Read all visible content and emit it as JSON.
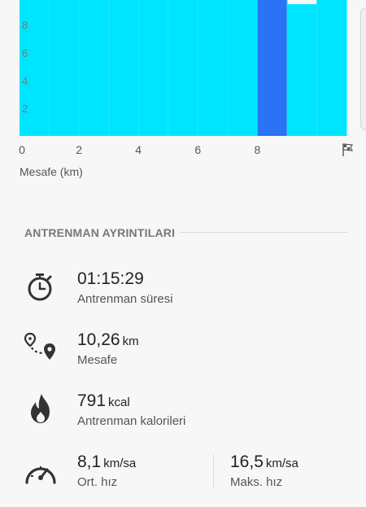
{
  "chart_data": {
    "type": "bar",
    "x_ticks": [
      "0",
      "2",
      "4",
      "6",
      "8"
    ],
    "finish_marker": "finish-flag-icon",
    "xlabel": "Mesafe (km)",
    "y_ticks": [
      "2",
      "4",
      "6",
      "8"
    ],
    "xlim": [
      0,
      11
    ],
    "ylim": [
      0,
      9.8
    ],
    "bars": [
      {
        "x0": 0,
        "x1": 1,
        "value": 16,
        "color": "#00e5ff"
      },
      {
        "x0": 1,
        "x1": 2,
        "value": 16,
        "color": "#00e5ff"
      },
      {
        "x0": 2,
        "x1": 3,
        "value": 16,
        "color": "#00e5ff"
      },
      {
        "x0": 3,
        "x1": 4,
        "value": 16,
        "color": "#00e5ff"
      },
      {
        "x0": 4,
        "x1": 5,
        "value": 16,
        "color": "#00e5ff"
      },
      {
        "x0": 5,
        "x1": 6,
        "value": 16,
        "color": "#00e5ff"
      },
      {
        "x0": 6,
        "x1": 7,
        "value": 16,
        "color": "#00e5ff"
      },
      {
        "x0": 7,
        "x1": 8,
        "value": 16,
        "color": "#00e5ff"
      },
      {
        "x0": 8,
        "x1": 9,
        "value": 16,
        "color": "#2a73f5"
      },
      {
        "x0": 9,
        "x1": 10,
        "value": 9.5,
        "color": "#00e5ff"
      },
      {
        "x0": 10,
        "x1": 11,
        "value": 16,
        "color": "#00e5ff"
      }
    ]
  },
  "section": {
    "title": "ANTRENMAN AYRINTILARI"
  },
  "details": {
    "duration": {
      "value": "01:15:29",
      "label": "Antrenman süresi",
      "icon": "stopwatch-icon"
    },
    "distance": {
      "value": "10,26",
      "unit": "km",
      "label": "Mesafe",
      "icon": "route-pin-icon"
    },
    "calories": {
      "value": "791",
      "unit": "kcal",
      "label": "Antrenman kalorileri",
      "icon": "flame-icon"
    },
    "avg_speed": {
      "value": "8,1",
      "unit": "km/sa",
      "label": "Ort. hız",
      "icon": "speedometer-icon"
    },
    "max_speed": {
      "value": "16,5",
      "unit": "km/sa",
      "label": "Maks. hız"
    }
  },
  "colors": {
    "bar": "#00e5ff",
    "highlight": "#2a73f5",
    "icon": "#333333"
  }
}
